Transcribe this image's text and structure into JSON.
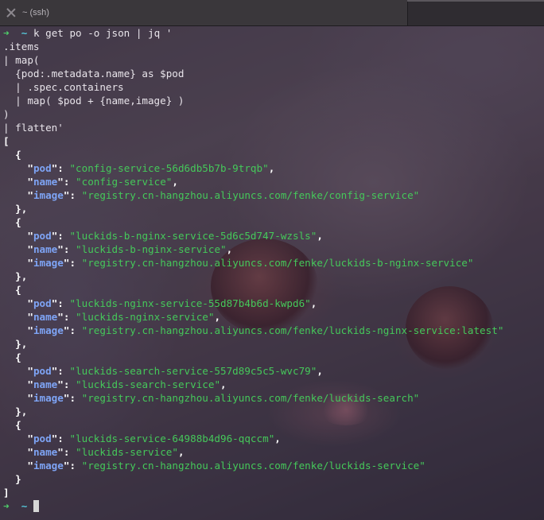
{
  "window": {
    "tab_title": "~ (ssh)"
  },
  "colors": {
    "prompt_arrow": "#4fd06a",
    "prompt_dir": "#56c6d8",
    "json_key": "#7ea4f5",
    "json_string": "#45c85a",
    "title_bar": "#2f2c31"
  },
  "terminal": {
    "prompt": {
      "arrow": "➜",
      "dir": "~"
    },
    "command": "k get po -o json | jq '",
    "jq_lines": [
      ".items",
      "| map(",
      "  {pod:.metadata.name} as $pod",
      "  | .spec.containers",
      "  | map( $pod + {name,image} )",
      ")",
      "| flatten'"
    ],
    "output": {
      "open_bracket": "[",
      "close_bracket": "]",
      "key_pod": "pod",
      "key_name": "name",
      "key_image": "image",
      "items": [
        {
          "pod": "config-service-56d6db5b7b-9trqb",
          "name": "config-service",
          "image": "registry.cn-hangzhou.aliyuncs.com/fenke/config-service"
        },
        {
          "pod": "luckids-b-nginx-service-5d6c5d747-wzsls",
          "name": "luckids-b-nginx-service",
          "image": "registry.cn-hangzhou.aliyuncs.com/fenke/luckids-b-nginx-service"
        },
        {
          "pod": "luckids-nginx-service-55d87b4b6d-kwpd6",
          "name": "luckids-nginx-service",
          "image": "registry.cn-hangzhou.aliyuncs.com/fenke/luckids-nginx-service:latest"
        },
        {
          "pod": "luckids-search-service-557d89c5c5-wvc79",
          "name": "luckids-search-service",
          "image": "registry.cn-hangzhou.aliyuncs.com/fenke/luckids-search"
        },
        {
          "pod": "luckids-service-64988b4d96-qqccm",
          "name": "luckids-service",
          "image": "registry.cn-hangzhou.aliyuncs.com/fenke/luckids-service"
        }
      ]
    }
  }
}
